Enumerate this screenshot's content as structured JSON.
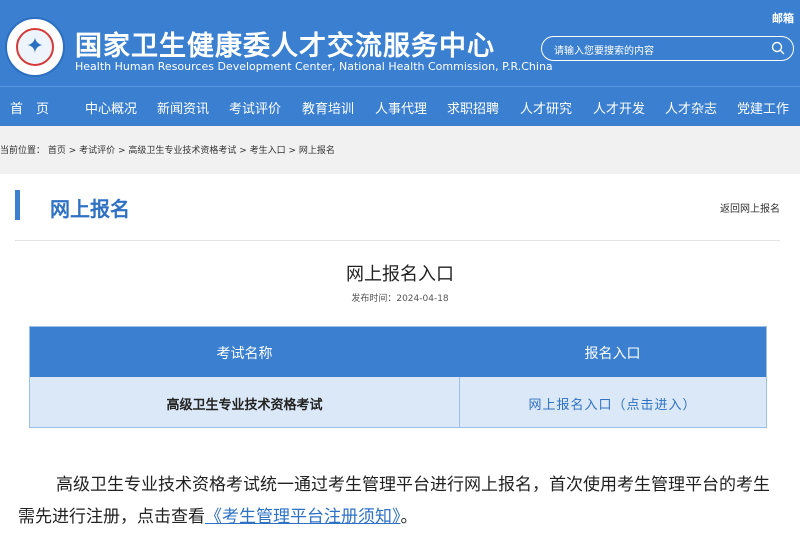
{
  "header": {
    "title_cn": "国家卫生健康委人才交流服务中心",
    "title_en": "Health Human Resources Development Center, National Health Commission, P.R.China",
    "mailbox": "邮箱",
    "search_placeholder": "请输入您要搜索的内容"
  },
  "nav": {
    "items": [
      "首　页",
      "中心概况",
      "新闻资讯",
      "考试评价",
      "教育培训",
      "人事代理",
      "求职招聘",
      "人才研究",
      "人才开发",
      "人才杂志",
      "党建工作"
    ]
  },
  "breadcrumb": "当前位置： 首页 > 考试评价 > 高级卫生专业技术资格考试 > 考生入口 > 网上报名",
  "section": {
    "title": "网上报名",
    "return_link": "返回网上报名"
  },
  "article": {
    "title": "网上报名入口",
    "date": "发布时间：2024-04-18"
  },
  "table": {
    "headers": [
      "考试名称",
      "报名入口"
    ],
    "rows": [
      {
        "name": "高级卫生专业技术资格考试",
        "link": "网上报名入口（点击进入）"
      }
    ]
  },
  "paragraph": {
    "text_before": "高级卫生专业技术资格考试统一通过考生管理平台进行网上报名，首次使用考生管理平台的考生需先进行注册，点击查看",
    "link_text": "《考生管理平台注册须知》",
    "text_after": "。"
  },
  "colors": {
    "primary": "#3a7fd0",
    "link": "#2f72c4",
    "table_row": "#dbe8f7"
  }
}
